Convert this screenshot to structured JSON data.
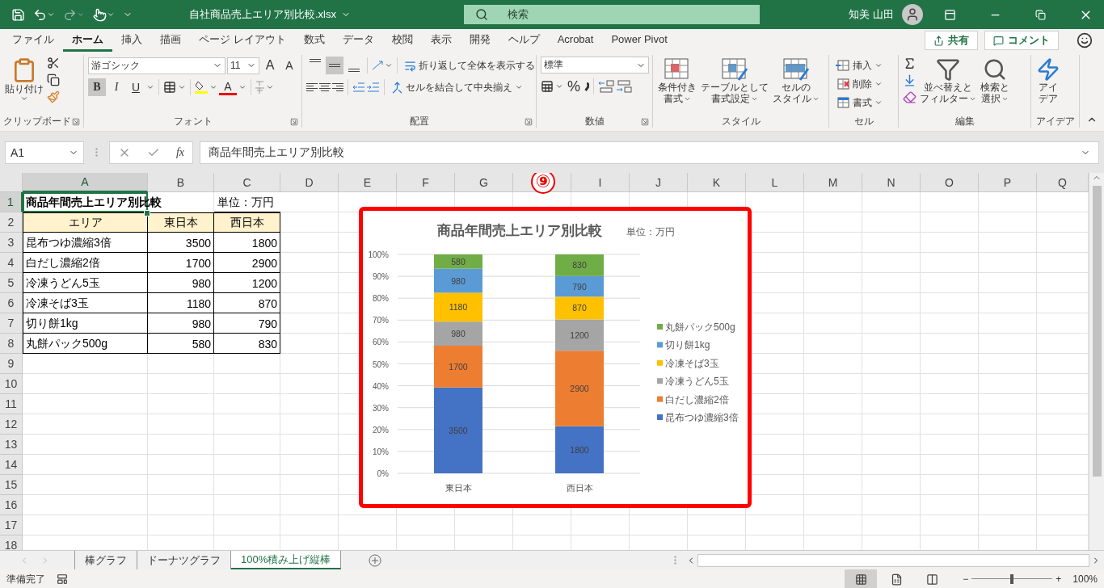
{
  "title_bar": {
    "filename": "自社商品売上エリア別比較.xlsx",
    "search": {
      "placeholder": "検索"
    },
    "user": "知美 山田"
  },
  "menu_tabs": [
    {
      "label": "ファイル",
      "selected": false
    },
    {
      "label": "ホーム",
      "selected": true
    },
    {
      "label": "挿入",
      "selected": false
    },
    {
      "label": "描画",
      "selected": false
    },
    {
      "label": "ページ レイアウト",
      "selected": false
    },
    {
      "label": "数式",
      "selected": false
    },
    {
      "label": "データ",
      "selected": false
    },
    {
      "label": "校閲",
      "selected": false
    },
    {
      "label": "表示",
      "selected": false
    },
    {
      "label": "開発",
      "selected": false
    },
    {
      "label": "ヘルプ",
      "selected": false
    },
    {
      "label": "Acrobat",
      "selected": false
    },
    {
      "label": "Power Pivot",
      "selected": false
    }
  ],
  "share_button": "共有",
  "comment_button": "コメント",
  "ribbon": {
    "clipboard": {
      "label": "クリップボード",
      "paste": "貼り付け"
    },
    "font": {
      "label": "フォント",
      "font_name": "游ゴシック",
      "font_size": "11",
      "grow": "A",
      "shrink": "A",
      "bold": {
        "text": "B",
        "selected": true
      },
      "italic": {
        "text": "I",
        "selected": false
      },
      "underline": {
        "text": "U",
        "selected": false
      },
      "font_color": "A"
    },
    "alignment": {
      "label": "配置",
      "vertical": [
        {
          "kind": "top",
          "selected": false
        },
        {
          "kind": "middle",
          "selected": true
        },
        {
          "kind": "bottom",
          "selected": false
        }
      ],
      "wrap": "折り返して全体を表示する",
      "merge": "セルを結合して中央揃え"
    },
    "number": {
      "label": "数値",
      "format": "標準",
      "percent": "%"
    },
    "styles": {
      "label": "スタイル",
      "buttons": [
        {
          "kind": "conditional",
          "lines": [
            "条件付き",
            "書式"
          ]
        },
        {
          "kind": "table",
          "lines": [
            "テーブルとして",
            "書式設定"
          ]
        },
        {
          "kind": "cell",
          "lines": [
            "セルの",
            "スタイル"
          ]
        }
      ]
    },
    "cells": {
      "label": "セル",
      "buttons": [
        {
          "kind": "insert",
          "text": "挿入"
        },
        {
          "kind": "delete",
          "text": "削除"
        },
        {
          "kind": "format",
          "text": "書式"
        }
      ]
    },
    "editing": {
      "label": "編集",
      "buttons": [
        {
          "kind": "sort",
          "lines": [
            "並べ替えと",
            "フィルター"
          ]
        },
        {
          "kind": "find",
          "lines": [
            "検索と",
            "選択"
          ]
        }
      ]
    },
    "ideas": {
      "label": "アイデア",
      "lines": [
        "アイ",
        "デア"
      ]
    }
  },
  "formula_bar": {
    "name_box": "A1",
    "function_label": "fx",
    "formula": "商品年間売上エリア別比較"
  },
  "columns": [
    {
      "kind": "letter",
      "label": "A",
      "selected": true
    },
    {
      "kind": "letter",
      "label": "B",
      "selected": false
    },
    {
      "kind": "letter",
      "label": "C",
      "selected": false
    },
    {
      "kind": "letter",
      "label": "D",
      "selected": false
    },
    {
      "kind": "letter",
      "label": "E",
      "selected": false
    },
    {
      "kind": "letter",
      "label": "F",
      "selected": false
    },
    {
      "kind": "letter",
      "label": "G",
      "selected": false
    },
    {
      "kind": "marker",
      "label": "⑨",
      "selected": false
    },
    {
      "kind": "letter",
      "label": "I",
      "selected": false
    },
    {
      "kind": "letter",
      "label": "J",
      "selected": false
    },
    {
      "kind": "letter",
      "label": "K",
      "selected": false
    },
    {
      "kind": "letter",
      "label": "L",
      "selected": false
    },
    {
      "kind": "letter",
      "label": "M",
      "selected": false
    },
    {
      "kind": "letter",
      "label": "N",
      "selected": false
    },
    {
      "kind": "letter",
      "label": "O",
      "selected": false
    },
    {
      "kind": "letter",
      "label": "P",
      "selected": false
    },
    {
      "kind": "letter",
      "label": "Q",
      "selected": false
    }
  ],
  "rows": [
    {
      "number": "1",
      "selected": true,
      "A": {
        "kind": "title",
        "text": "商品年間売上エリア別比較"
      },
      "C": {
        "kind": "unit",
        "text": "単位：万円"
      }
    },
    {
      "number": "2",
      "selected": false,
      "A": {
        "kind": "header",
        "text": "エリア"
      },
      "B": {
        "kind": "header",
        "text": "東日本"
      },
      "C": {
        "kind": "header",
        "text": "西日本"
      }
    },
    {
      "number": "3",
      "selected": false,
      "A": {
        "kind": "label",
        "text": "昆布つゆ濃縮3倍"
      },
      "B": {
        "kind": "number",
        "text": "3500"
      },
      "C": {
        "kind": "number",
        "text": "1800"
      }
    },
    {
      "number": "4",
      "selected": false,
      "A": {
        "kind": "label",
        "text": "白だし濃縮2倍"
      },
      "B": {
        "kind": "number",
        "text": "1700"
      },
      "C": {
        "kind": "number",
        "text": "2900"
      }
    },
    {
      "number": "5",
      "selected": false,
      "A": {
        "kind": "label",
        "text": "冷凍うどん5玉"
      },
      "B": {
        "kind": "number",
        "text": "980"
      },
      "C": {
        "kind": "number",
        "text": "1200"
      }
    },
    {
      "number": "6",
      "selected": false,
      "A": {
        "kind": "label",
        "text": "冷凍そば3玉"
      },
      "B": {
        "kind": "number",
        "text": "1180"
      },
      "C": {
        "kind": "number",
        "text": "870"
      }
    },
    {
      "number": "7",
      "selected": false,
      "A": {
        "kind": "label",
        "text": "切り餅1kg"
      },
      "B": {
        "kind": "number",
        "text": "980"
      },
      "C": {
        "kind": "number",
        "text": "790"
      }
    },
    {
      "number": "8",
      "selected": false,
      "A": {
        "kind": "label",
        "text": "丸餅パック500g"
      },
      "B": {
        "kind": "number",
        "text": "580"
      },
      "C": {
        "kind": "number",
        "text": "830"
      }
    },
    {
      "number": "9",
      "selected": false
    },
    {
      "number": "10",
      "selected": false
    },
    {
      "number": "11",
      "selected": false
    },
    {
      "number": "12",
      "selected": false
    },
    {
      "number": "13",
      "selected": false
    },
    {
      "number": "14",
      "selected": false
    },
    {
      "number": "15",
      "selected": false
    },
    {
      "number": "16",
      "selected": false
    },
    {
      "number": "17",
      "selected": false
    },
    {
      "number": "18",
      "selected": false
    }
  ],
  "chart": {
    "unit": "単位：万円",
    "chart_data": {
      "type": "bar",
      "title": "商品年間売上エリア別比較",
      "stacked": true,
      "grid": true,
      "legend": "right",
      "categories": [
        "東日本",
        "西日本"
      ],
      "ylim": [
        0,
        1
      ],
      "yticks": [
        {
          "value": 0,
          "label": "0%"
        },
        {
          "value": 0.1,
          "label": "10%"
        },
        {
          "value": 0.2,
          "label": "20%"
        },
        {
          "value": 0.3,
          "label": "30%"
        },
        {
          "value": 0.4,
          "label": "40%"
        },
        {
          "value": 0.5,
          "label": "50%"
        },
        {
          "value": 0.6,
          "label": "60%"
        },
        {
          "value": 0.7,
          "label": "70%"
        },
        {
          "value": 0.8,
          "label": "80%"
        },
        {
          "value": 0.9,
          "label": "90%"
        },
        {
          "value": 1,
          "label": "100%"
        }
      ],
      "series": [
        {
          "name": "昆布つゆ濃縮3倍",
          "color": "#4472c4",
          "values": [
            0.392,
            0.215
          ]
        },
        {
          "name": "白だし濃縮2倍",
          "color": "#ed7d31",
          "values": [
            0.191,
            0.345
          ]
        },
        {
          "name": "冷凍うどん5玉",
          "color": "#a5a5a5",
          "values": [
            0.11,
            0.143
          ]
        },
        {
          "name": "冷凍そば3玉",
          "color": "#ffc000",
          "values": [
            0.132,
            0.104
          ]
        },
        {
          "name": "切り餅1kg",
          "color": "#5b9bd5",
          "values": [
            0.11,
            0.094
          ]
        },
        {
          "name": "丸餅パック500g",
          "color": "#70ad47",
          "values": [
            0.065,
            0.099
          ]
        }
      ],
      "annotations": [
        "3500",
        "1800",
        "1700",
        "2900",
        "980",
        "1200",
        "1180",
        "870",
        "980",
        "790",
        "580",
        "830"
      ]
    }
  },
  "sheet_tabs": [
    {
      "label": "棒グラフ",
      "selected": false
    },
    {
      "label": "ドーナツグラフ",
      "selected": false
    },
    {
      "label": "100%積み上げ縦棒",
      "selected": true
    }
  ],
  "status_bar": {
    "status": "準備完了",
    "views": [
      {
        "kind": "normal",
        "selected": true
      },
      {
        "kind": "page_layout",
        "selected": false
      },
      {
        "kind": "page_break",
        "selected": false
      }
    ],
    "zoom_out": "−",
    "zoom_in": "+",
    "zoom": {
      "level": 0.5
    },
    "zoom_reading": "100%"
  }
}
